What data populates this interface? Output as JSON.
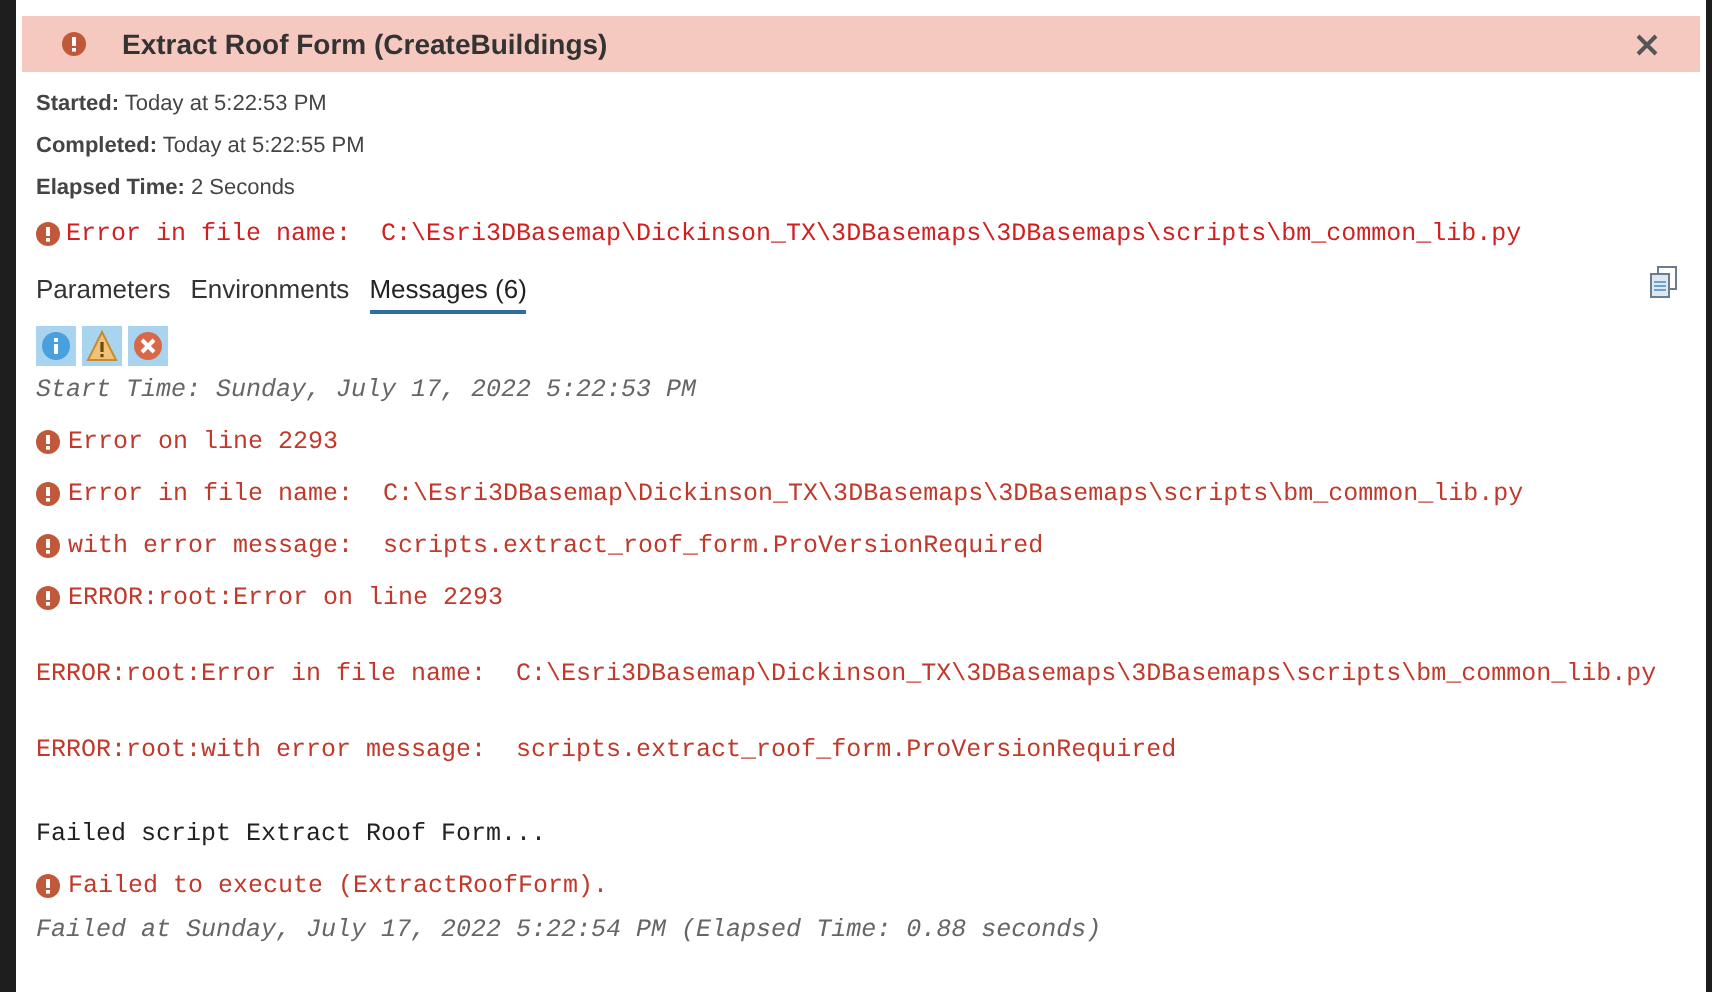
{
  "header": {
    "title": "Extract Roof Form (CreateBuildings)"
  },
  "details": [
    {
      "label": "Started:",
      "value": "Today at 5:22:53 PM"
    },
    {
      "label": "Completed:",
      "value": "Today at 5:22:55 PM"
    },
    {
      "label": "Elapsed Time:",
      "value": "2 Seconds"
    }
  ],
  "summary_error": "Error in file name:  C:\\Esri3DBasemap\\Dickinson_TX\\3DBasemaps\\3DBasemaps\\scripts\\bm_common_lib.py",
  "tabs": [
    {
      "label": "Parameters",
      "selected": false
    },
    {
      "label": "Environments",
      "selected": false
    },
    {
      "label": "Messages (6)",
      "selected": true
    }
  ],
  "filters": [
    {
      "kind": "info",
      "selected": true
    },
    {
      "kind": "warning",
      "selected": true
    },
    {
      "kind": "error",
      "selected": true
    }
  ],
  "messages": [
    {
      "kind": "info",
      "text": "Start Time: Sunday, July 17, 2022 5:22:53 PM"
    },
    {
      "kind": "error",
      "text": "Error on line 2293"
    },
    {
      "kind": "error",
      "text": "Error in file name:  C:\\Esri3DBasemap\\Dickinson_TX\\3DBasemaps\\3DBasemaps\\scripts\\bm_common_lib.py"
    },
    {
      "kind": "error",
      "text": "with error message:  scripts.extract_roof_form.ProVersionRequired"
    },
    {
      "kind": "error",
      "text": "ERROR:root:Error on line 2293"
    },
    {
      "kind": "error_plain",
      "text": "ERROR:root:Error in file name:  C:\\Esri3DBasemap\\Dickinson_TX\\3DBasemaps\\3DBasemaps\\scripts\\bm_common_lib.py"
    },
    {
      "kind": "error_plain",
      "text": "ERROR:root:with error message:  scripts.extract_roof_form.ProVersionRequired"
    },
    {
      "kind": "text",
      "text": "Failed script Extract Roof Form..."
    },
    {
      "kind": "error",
      "text": "Failed to execute (ExtractRoofForm)."
    },
    {
      "kind": "info",
      "text": "Failed at Sunday, July 17, 2022 5:22:54 PM (Elapsed Time: 0.88 seconds)"
    }
  ]
}
